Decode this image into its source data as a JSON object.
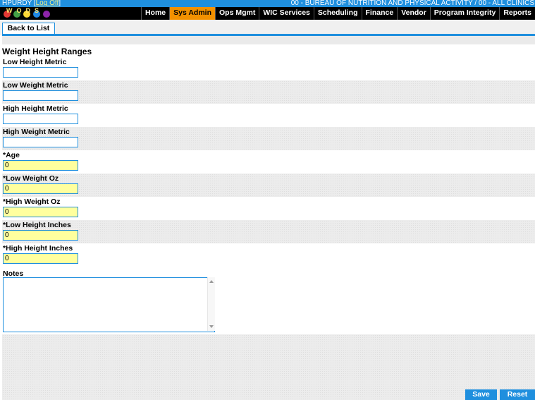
{
  "topbar": {
    "user": "HPURDY",
    "logoff": "Log Off",
    "clinic": "00 - BUREAU OF NUTRITION AND PHYSICAL ACTIVITY / 00 - ALL CLINICS"
  },
  "logo": {
    "text": "WODS",
    "colors": [
      "#e53935",
      "#43a047",
      "#fdd835",
      "#1e88e5",
      "#8e24aa"
    ]
  },
  "menu": [
    "Home",
    "Sys Admin",
    "Ops Mgmt",
    "WIC Services",
    "Scheduling",
    "Finance",
    "Vendor",
    "Program Integrity",
    "Reports"
  ],
  "toolbar": {
    "back_label": "Back to List"
  },
  "form": {
    "title": "Weight Height Ranges",
    "fields": [
      {
        "label": "Low Height Metric",
        "value": ""
      },
      {
        "label": "Low Weight Metric",
        "value": ""
      },
      {
        "label": "High Height Metric",
        "value": ""
      },
      {
        "label": "High Weight Metric",
        "value": ""
      },
      {
        "label": "*Age",
        "value": "0"
      },
      {
        "label": "*Low Weight Oz",
        "value": "0"
      },
      {
        "label": "*High Weight Oz",
        "value": "0"
      },
      {
        "label": "*Low Height Inches",
        "value": "0"
      },
      {
        "label": "*High Height Inches",
        "value": "0"
      }
    ],
    "notes_label": "Notes",
    "notes_value": ""
  },
  "actions": {
    "save_label": "Save",
    "reset_label": "Reset"
  },
  "colors": {
    "accent": "#1f8fde",
    "active_menu": "#f29100",
    "required_bg": "#ffff9e"
  }
}
